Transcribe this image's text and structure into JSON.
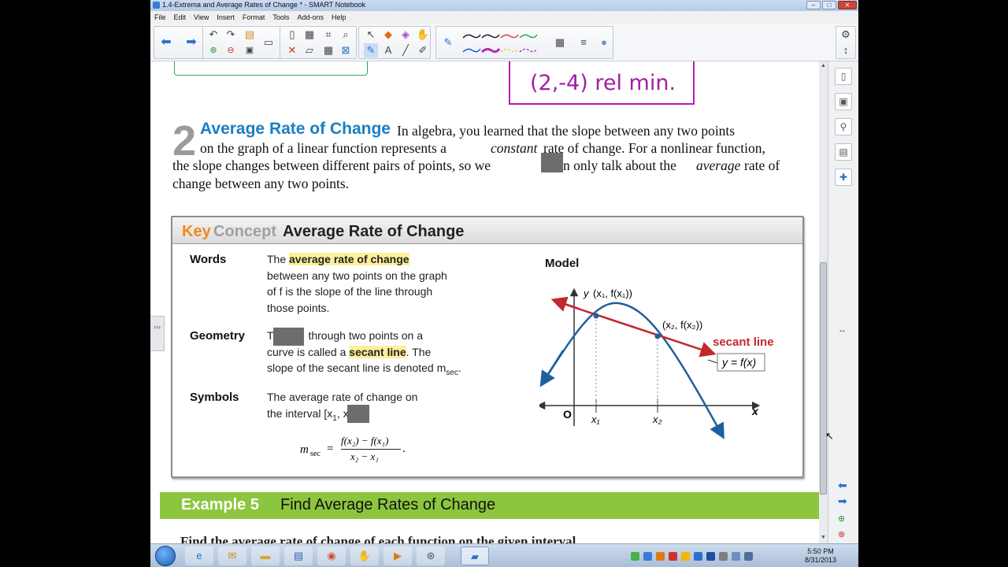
{
  "window": {
    "title": "1.4-Extrema and Average Rates of Change * - SMART Notebook",
    "controls": [
      "–",
      "□",
      "✕"
    ]
  },
  "menu": [
    "File",
    "Edit",
    "View",
    "Insert",
    "Format",
    "Tools",
    "Add-ons",
    "Help"
  ],
  "toolbar": {
    "icons": [
      "back-arrow-icon",
      "forward-arrow-icon",
      "undo-icon",
      "redo-icon",
      "add-page-icon",
      "delete-page-icon",
      "screen-shade-icon",
      "table-icon",
      "select-icon",
      "pen-icon",
      "eraser-icon",
      "line-icon",
      "text-icon",
      "fill-icon",
      "properties-icon",
      "settings-icon"
    ],
    "pen_colors": [
      "#1a1a1a",
      "#1a1a1a",
      "#e0383b",
      "#2aa146",
      "#1a5bd6",
      "#b02fb0",
      "#f3d019",
      "#b02fb0",
      "#1a1a1a"
    ]
  },
  "annotation": {
    "text": "(2,-4) rel min."
  },
  "section": {
    "number": "2",
    "title": "Average Rate of Change",
    "lines": [
      "In algebra, you learned that the slope between any two points",
      "on the graph of a linear function represents a",
      "constant",
      "rate of change. For a nonlinear function,",
      "the slope changes between different pairs of points, so we",
      "n only talk about the",
      "average",
      "rate of",
      "change between any two points."
    ]
  },
  "key_concept": {
    "key": "Key",
    "concept": "Concept",
    "title": "Average Rate of Change",
    "words_label": "Words",
    "words_pre": "The ",
    "words_hl": "average rate of change",
    "words_post_1": "between any two points on the graph",
    "words_post_2": "of f is the slope of the line through",
    "words_post_3": "those points.",
    "geometry_label": "Geometry",
    "geometry_1a": "T",
    "geometry_1b": " through two points on a",
    "geometry_2a": "curve is called a ",
    "geometry_hl": "secant line",
    "geometry_2b": ". The",
    "geometry_3": "slope of the secant line is denoted m",
    "geometry_3_sub": "sec",
    "geometry_3_end": ".",
    "symbols_label": "Symbols",
    "symbols_1": "The average rate of change on",
    "symbols_2": "the interval [x",
    "symbols_2_sub": "1",
    "symbols_2_end": ", x",
    "formula_m": "m",
    "formula_sub": "sec",
    "formula_eq": "=",
    "formula_num": "f(x₂) − f(x₁)",
    "formula_den": "x₂ − x₁",
    "model_label": "Model",
    "graph": {
      "y_axis": "y",
      "x_axis": "x",
      "origin": "O",
      "point1": "(x₁, f(x₁))",
      "point2": "(x₂, f(x₂))",
      "x1": "x₁",
      "x2": "x₂",
      "secant_label": "secant line",
      "curve_label": "y = f(x)",
      "secant_color": "#c3282f",
      "curve_color": "#1f5f9f"
    }
  },
  "example": {
    "number": "Example 5",
    "title": "Find Average Rates of Change"
  },
  "bottom_text": "Find the average rate of change of each function on the given interval.",
  "taskbar": {
    "icons": [
      "start-orb-icon",
      "internet-explorer-icon",
      "outlook-icon",
      "folder-icon",
      "notepad-icon",
      "chrome-icon",
      "smart-board-icon",
      "media-player-icon",
      "network-icon",
      "notebook-icon"
    ],
    "time": "5:50 PM",
    "date": "8/31/2013"
  }
}
